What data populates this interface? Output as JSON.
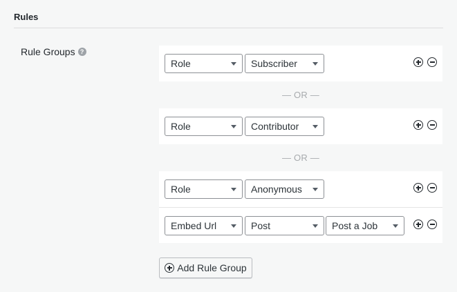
{
  "section": {
    "title": "Rules"
  },
  "field": {
    "label": "Rule Groups",
    "help_glyph": "?"
  },
  "separator": "— OR —",
  "groups": [
    {
      "rules": [
        {
          "selects": [
            "Role",
            "Subscriber"
          ]
        }
      ]
    },
    {
      "rules": [
        {
          "selects": [
            "Role",
            "Contributor"
          ]
        }
      ]
    },
    {
      "rules": [
        {
          "selects": [
            "Role",
            "Anonymous"
          ]
        },
        {
          "selects": [
            "Embed Url",
            "Post",
            "Post a Job"
          ]
        }
      ]
    }
  ],
  "add_button": {
    "label": "Add Rule Group",
    "icon": "plus-circle-icon"
  },
  "icons": {
    "add_rule": "plus-circle-icon",
    "remove_rule": "minus-circle-icon"
  }
}
